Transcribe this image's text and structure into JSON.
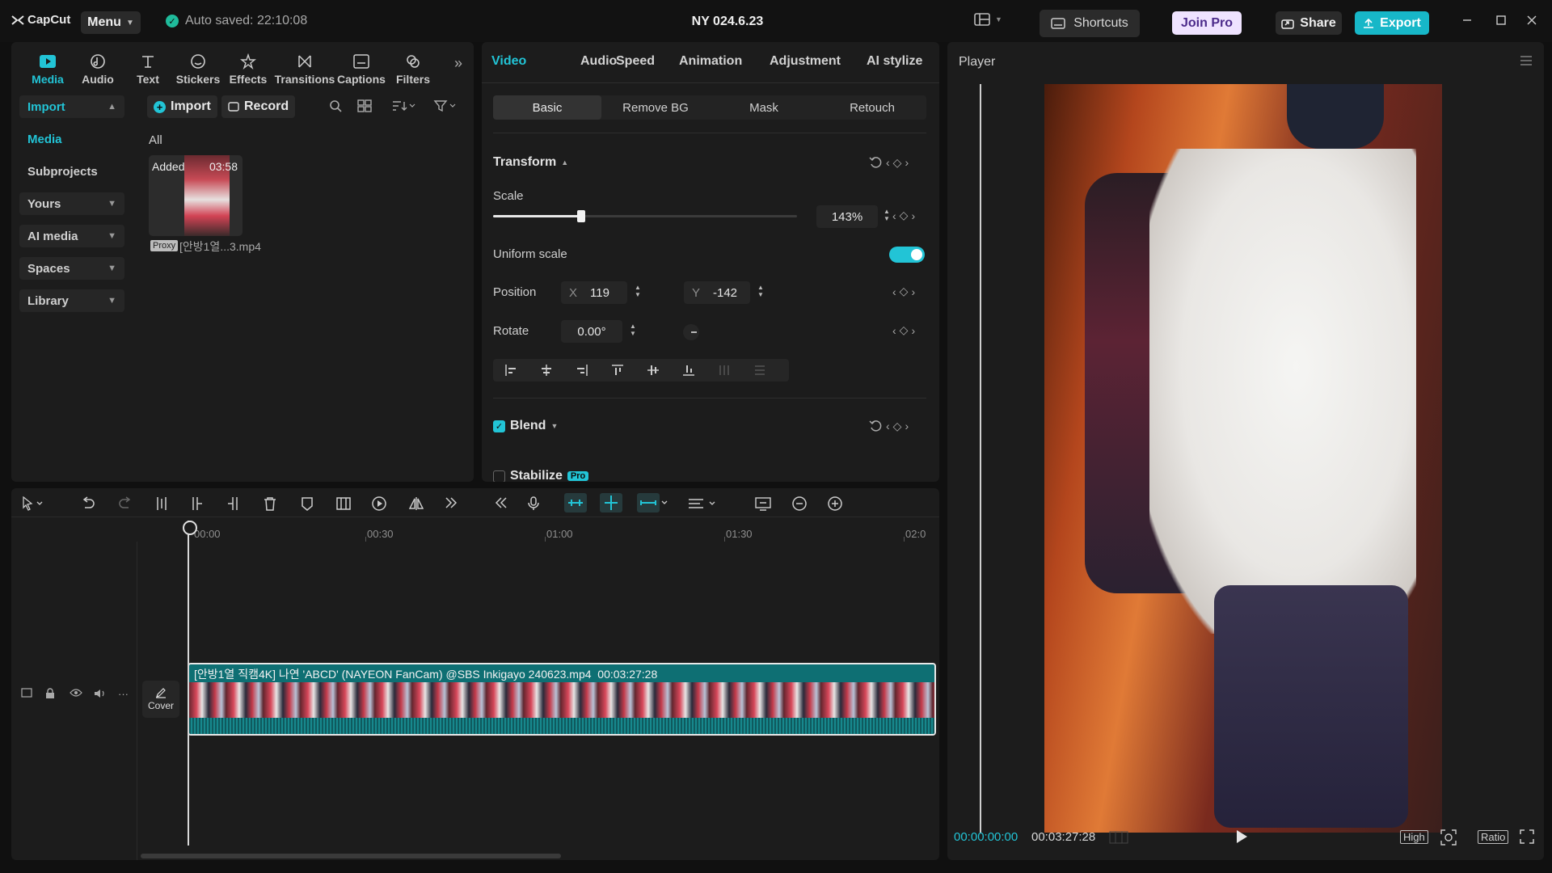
{
  "app": {
    "name": "CapCut",
    "menu_label": "Menu",
    "autosave": "Auto saved: 22:10:08",
    "project_title": "NY 024.6.23",
    "shortcuts": "Shortcuts",
    "join_pro": "Join Pro",
    "share": "Share",
    "export": "Export"
  },
  "media_tabs": [
    {
      "label": "Media",
      "icon": "media-icon"
    },
    {
      "label": "Audio",
      "icon": "audio-icon"
    },
    {
      "label": "Text",
      "icon": "text-icon"
    },
    {
      "label": "Stickers",
      "icon": "stickers-icon"
    },
    {
      "label": "Effects",
      "icon": "effects-icon"
    },
    {
      "label": "Transitions",
      "icon": "transitions-icon"
    },
    {
      "label": "Captions",
      "icon": "captions-icon"
    },
    {
      "label": "Filters",
      "icon": "filters-icon"
    }
  ],
  "sidebar": {
    "import": "Import",
    "media": "Media",
    "subprojects": "Subprojects",
    "yours": "Yours",
    "ai_media": "AI media",
    "spaces": "Spaces",
    "library": "Library"
  },
  "media": {
    "import_btn": "Import",
    "record_btn": "Record",
    "filter_label": "All",
    "item": {
      "badge": "Added",
      "duration": "03:58",
      "proxy": "Proxy",
      "filename": "[안방1열...3.mp4"
    }
  },
  "props": {
    "tabs": [
      "Video",
      "Audio",
      "Speed",
      "Animation",
      "Adjustment",
      "AI stylize"
    ],
    "subtabs": [
      "Basic",
      "Remove BG",
      "Mask",
      "Retouch"
    ],
    "transform": "Transform",
    "scale_label": "Scale",
    "scale_value": "143%",
    "scale_fraction": 0.29,
    "uniform_scale": "Uniform scale",
    "position_label": "Position",
    "x_label": "X",
    "x_value": "119",
    "y_label": "Y",
    "y_value": "-142",
    "rotate_label": "Rotate",
    "rotate_value": "0.00°",
    "blend": "Blend",
    "stabilize": "Stabilize",
    "pro_badge": "Pro"
  },
  "player": {
    "title": "Player",
    "current_time": "00:00:00:00",
    "total_time": "00:03:27:28",
    "high": "High",
    "ratio": "Ratio"
  },
  "timeline": {
    "ruler": [
      "00:00",
      "00:30",
      "01:00",
      "01:30",
      "02:0"
    ],
    "cover": "Cover",
    "clip_title": "[안방1열 직캠4K] 나연 'ABCD' (NAYEON FanCam) @SBS Inkigayo 240623.mp4",
    "clip_duration": "00:03:27:28"
  },
  "colors": {
    "accent": "#22c4d6",
    "background": "#101010",
    "panel": "#1c1c1c",
    "export": "#17b7c8"
  }
}
